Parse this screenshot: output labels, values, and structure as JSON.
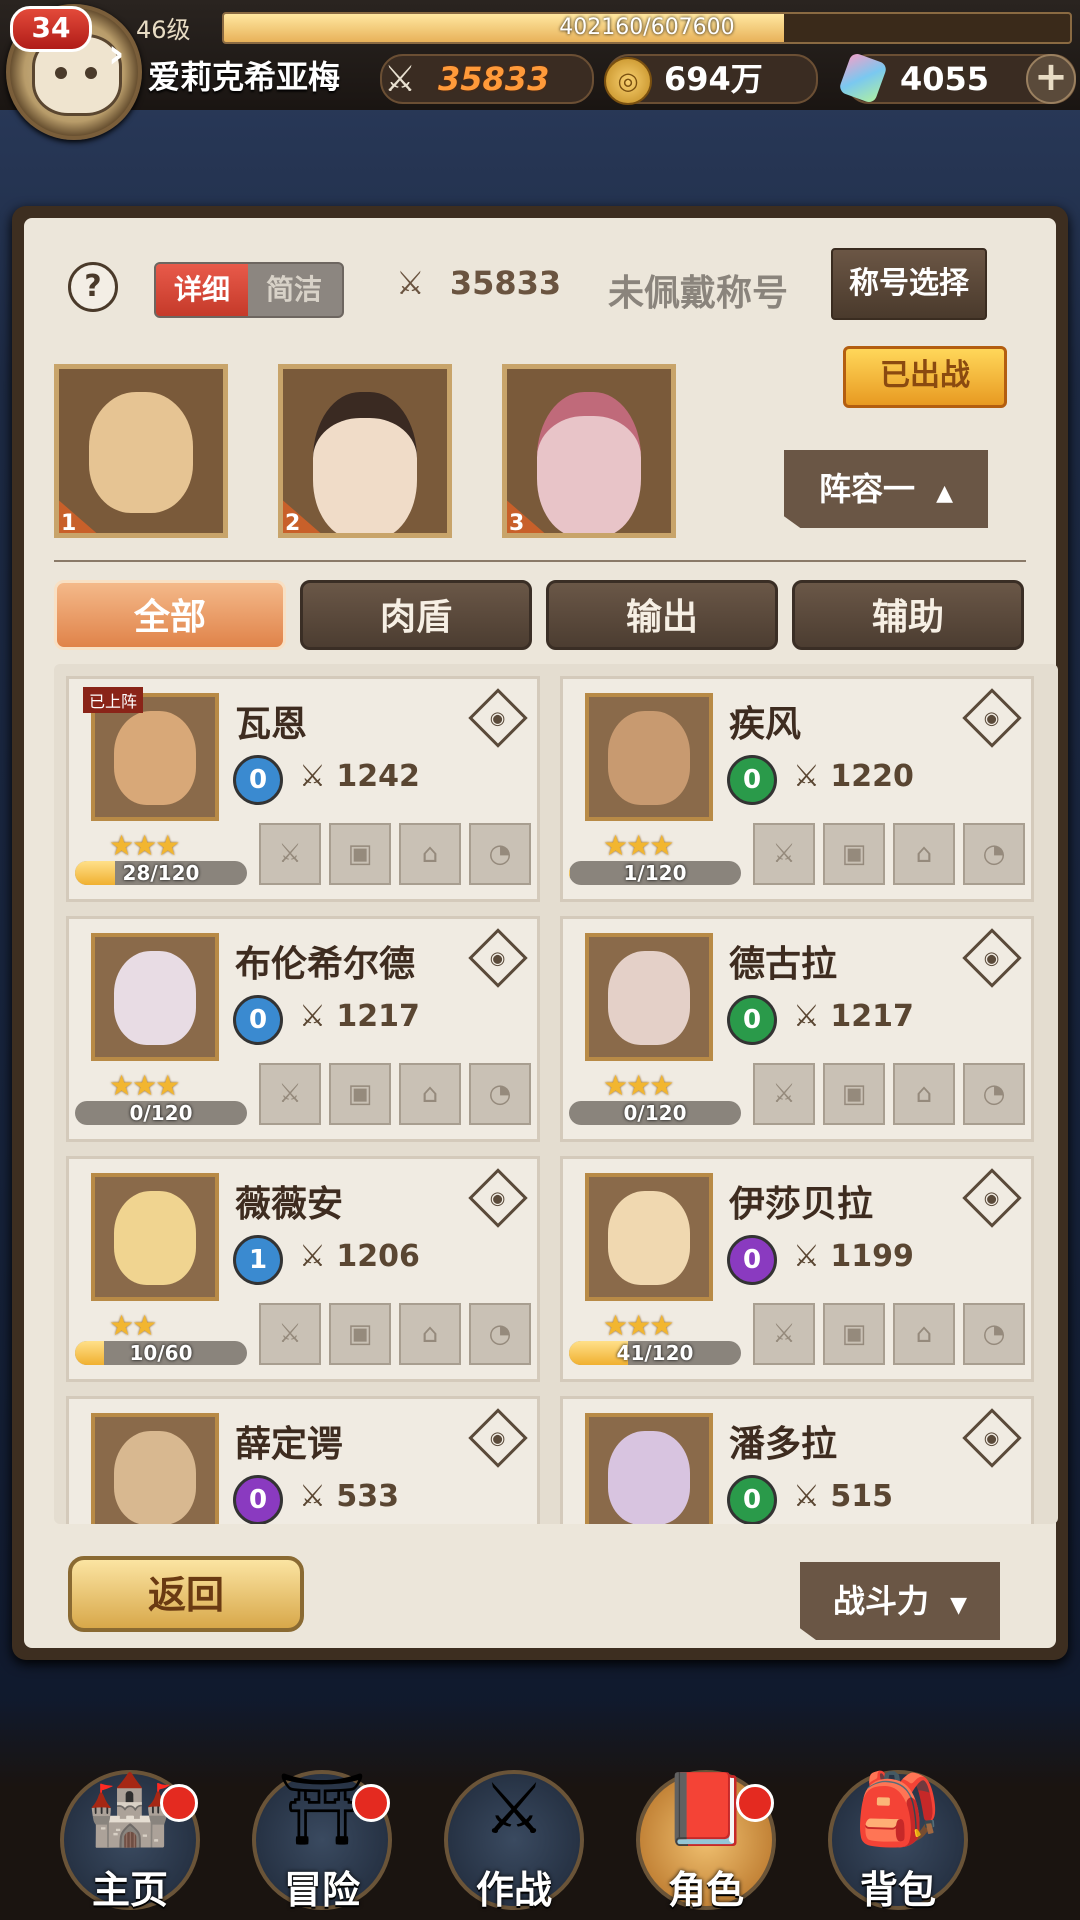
{
  "player": {
    "level_badge": "34",
    "account_level": "46级",
    "exp_text": "402160/607600",
    "exp_fraction": 0.662,
    "name": "爱莉克希亚梅"
  },
  "resources": {
    "power": "35833",
    "gold": "694万",
    "gems": "4055"
  },
  "panel": {
    "help": "?",
    "view_detail": "详细",
    "view_simple": "简洁",
    "team_power": "35833",
    "title_status": "未佩戴称号",
    "title_select": "称号选择",
    "deployed": "已出战",
    "lineup": "阵容一",
    "lineup_arrow": "▲",
    "slots": [
      "1",
      "2",
      "3"
    ]
  },
  "tabs": [
    "全部",
    "肉盾",
    "输出",
    "辅助"
  ],
  "heroes": [
    {
      "name": "瓦恩",
      "role": "0",
      "role_color": "#3a8ad0",
      "power": "1242",
      "stars": "★★★",
      "exp": "28/120",
      "exp_fraction": 0.233,
      "tag": "已上阵"
    },
    {
      "name": "疾风",
      "role": "0",
      "role_color": "#2a9a4a",
      "power": "1220",
      "stars": "★★★",
      "exp": "1/120",
      "exp_fraction": 0.008,
      "tag": ""
    },
    {
      "name": "布伦希尔德",
      "role": "0",
      "role_color": "#3a8ad0",
      "power": "1217",
      "stars": "★★★",
      "exp": "0/120",
      "exp_fraction": 0,
      "tag": ""
    },
    {
      "name": "德古拉",
      "role": "0",
      "role_color": "#2a9a4a",
      "power": "1217",
      "stars": "★★★",
      "exp": "0/120",
      "exp_fraction": 0,
      "tag": ""
    },
    {
      "name": "薇薇安",
      "role": "1",
      "role_color": "#3a8ad0",
      "power": "1206",
      "stars": "★★",
      "exp": "10/60",
      "exp_fraction": 0.167,
      "tag": ""
    },
    {
      "name": "伊莎贝拉",
      "role": "0",
      "role_color": "#8a3ac0",
      "power": "1199",
      "stars": "★★★",
      "exp": "41/120",
      "exp_fraction": 0.342,
      "tag": ""
    },
    {
      "name": "薛定谔",
      "role": "0",
      "role_color": "#8a3ac0",
      "power": "533",
      "stars": "",
      "exp": "",
      "exp_fraction": 0,
      "tag": ""
    },
    {
      "name": "潘多拉",
      "role": "0",
      "role_color": "#2a9a4a",
      "power": "515",
      "stars": "",
      "exp": "",
      "exp_fraction": 0,
      "tag": ""
    }
  ],
  "footer": {
    "back": "返回",
    "sort": "战斗力",
    "sort_arrow": "▼"
  },
  "nav": [
    {
      "label": "主页",
      "icon": "castle-icon",
      "badge": true
    },
    {
      "label": "冒险",
      "icon": "portal-icon",
      "badge": true
    },
    {
      "label": "作战",
      "icon": "battle-icon",
      "badge": false
    },
    {
      "label": "角色",
      "icon": "book-icon",
      "badge": true
    },
    {
      "label": "背包",
      "icon": "bag-icon",
      "badge": false
    }
  ]
}
